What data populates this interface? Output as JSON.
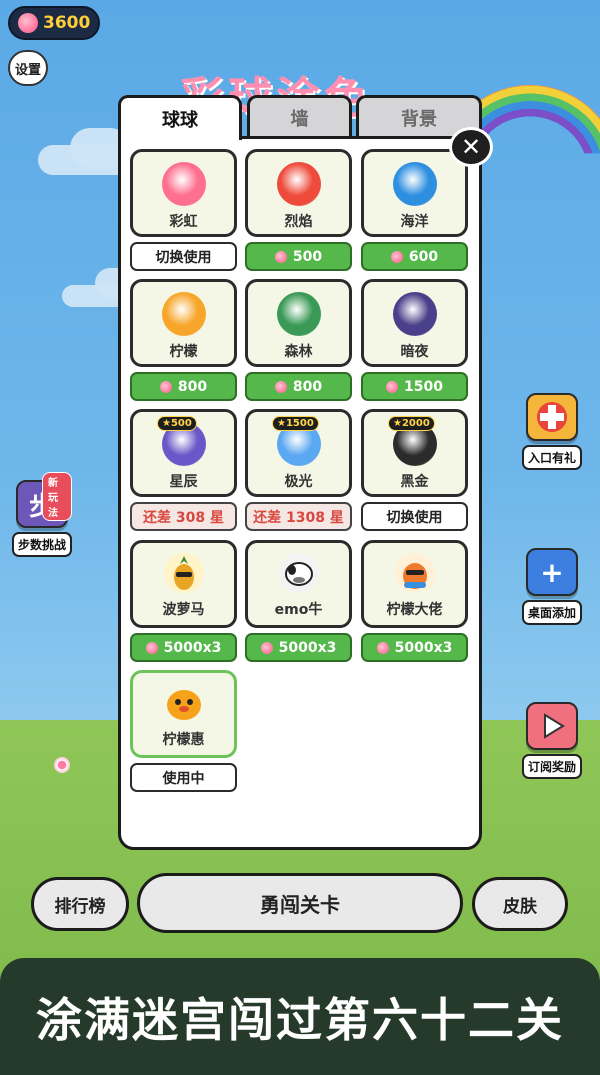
{
  "hud": {
    "coins": "3600",
    "settings_label": "设置"
  },
  "background": {
    "title_art": "彩球涂色"
  },
  "tabs": [
    {
      "label": "球球",
      "active": true
    },
    {
      "label": "墙",
      "active": false
    },
    {
      "label": "背景",
      "active": false
    }
  ],
  "items": [
    {
      "name": "彩虹",
      "action": "切换使用",
      "style": "white",
      "color": "#ff6f8f"
    },
    {
      "name": "烈焰",
      "action": "500",
      "style": "green",
      "color": "#ef4b3c"
    },
    {
      "name": "海洋",
      "action": "600",
      "style": "green",
      "color": "#2e8fe0"
    },
    {
      "name": "柠檬",
      "action": "800",
      "style": "green",
      "color": "#f7a62a"
    },
    {
      "name": "森林",
      "action": "800",
      "style": "green",
      "color": "#3a9a55"
    },
    {
      "name": "暗夜",
      "action": "1500",
      "style": "green",
      "color": "#4a3f8a"
    },
    {
      "name": "星辰",
      "action": "还差 308 星",
      "style": "short",
      "color": "#6a57c8",
      "star": "★500"
    },
    {
      "name": "极光",
      "action": "还差 1308 星",
      "style": "short",
      "color": "#5aa7f2",
      "star": "★1500"
    },
    {
      "name": "黑金",
      "action": "切换使用",
      "style": "white",
      "color": "#2b2b2b",
      "star": "★2000"
    },
    {
      "name": "波萝马",
      "action": "5000x3",
      "style": "green",
      "pet": "pineapple"
    },
    {
      "name": "emo牛",
      "action": "5000x3",
      "style": "green",
      "pet": "cow"
    },
    {
      "name": "柠檬大佬",
      "action": "5000x3",
      "style": "green",
      "pet": "boss"
    },
    {
      "name": "柠檬惠",
      "action": "使用中",
      "style": "white",
      "pet": "chick",
      "using": true
    }
  ],
  "side": {
    "step_label": "步数挑战",
    "step_glyph": "步",
    "step_new": "新玩法",
    "gift_label": "入口有礼",
    "add_label": "桌面添加",
    "sub_label": "订阅奖励"
  },
  "bottom": {
    "rank": "排行榜",
    "brave": "勇闯关卡",
    "skin": "皮肤"
  },
  "banner": "涂满迷宫闯过第六十二关"
}
